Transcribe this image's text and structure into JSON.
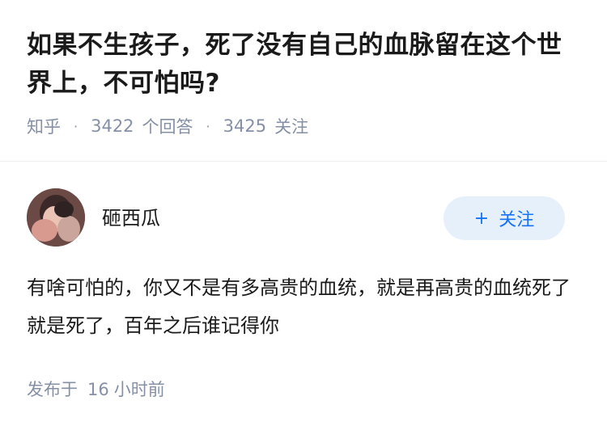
{
  "question": {
    "title": "如果不生孩子，死了没有自己的血脉留在这个世界上，不可怕吗?",
    "source": "知乎",
    "answer_count": "3422",
    "answer_label": "个回答",
    "follower_count": "3425",
    "follower_label": "关注"
  },
  "answer": {
    "author": {
      "name": "砸西瓜",
      "avatar_icon": "avatar-photo"
    },
    "follow_button": {
      "icon": "+",
      "label": "关注"
    },
    "content": "有啥可怕的，你又不是有多高贵的血统，就是再高贵的血统死了就是死了，百年之后谁记得你",
    "time_prefix": "发布于",
    "time_value": "16",
    "time_unit": "小时前"
  },
  "colors": {
    "primary_text": "#1a1a1a",
    "meta_text": "#8590a6",
    "accent": "#1772f6",
    "follow_bg": "#e6f0fb"
  }
}
